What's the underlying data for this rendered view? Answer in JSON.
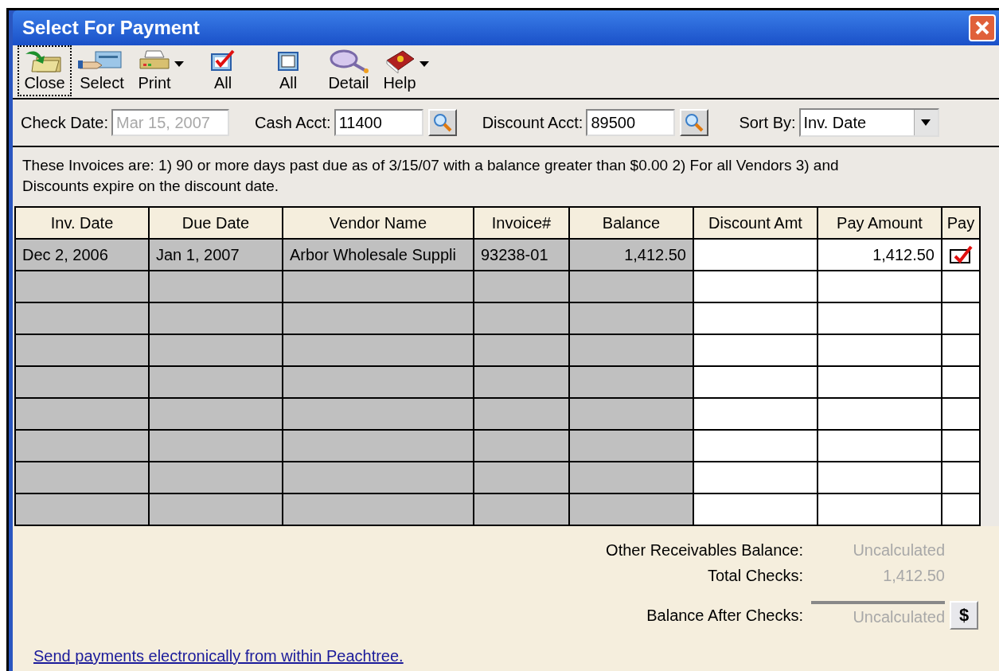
{
  "window": {
    "title": "Select For Payment"
  },
  "toolbar": [
    {
      "kind": "close",
      "label": "Close",
      "focused": true,
      "dropdown": false
    },
    {
      "kind": "select",
      "label": "Select",
      "focused": false,
      "dropdown": false
    },
    {
      "kind": "print",
      "label": "Print",
      "focused": false,
      "dropdown": true
    },
    {
      "kind": "check-all",
      "label": "All",
      "focused": false,
      "dropdown": false
    },
    {
      "kind": "uncheck-all",
      "label": "All",
      "focused": false,
      "dropdown": false
    },
    {
      "kind": "detail",
      "label": "Detail",
      "focused": false,
      "dropdown": false
    },
    {
      "kind": "help",
      "label": "Help",
      "focused": false,
      "dropdown": true
    }
  ],
  "fields": {
    "check_date": {
      "label": "Check Date:",
      "value": "Mar 15, 2007",
      "disabled": true
    },
    "cash_acct": {
      "label": "Cash Acct:",
      "value": "11400"
    },
    "discount_acct": {
      "label": "Discount Acct:",
      "value": "89500"
    },
    "sort_by": {
      "label": "Sort By:",
      "value": "Inv. Date"
    }
  },
  "description": "These Invoices are: 1) 90 or more days past due as of 3/15/07 with a balance greater than $0.00 2) For all Vendors 3) and Discounts expire on the discount date.",
  "table": {
    "columns": [
      "Inv. Date",
      "Due Date",
      "Vendor Name",
      "Invoice#",
      "Balance",
      "Discount Amt",
      "Pay Amount",
      "Pay"
    ],
    "rows": [
      {
        "inv_date": "Dec 2, 2006",
        "due_date": "Jan 1, 2007",
        "vendor_name": "Arbor Wholesale Suppli",
        "invoice": "93238-01",
        "balance": "1,412.50",
        "discount_amt": "",
        "pay_amount": "1,412.50",
        "pay": true
      }
    ]
  },
  "summary": [
    {
      "label": "Other Receivables Balance:",
      "value": "Uncalculated"
    },
    {
      "label": "Total Checks:",
      "value": "1,412.50"
    },
    {
      "label": "Balance After Checks:",
      "value": "Uncalculated"
    }
  ],
  "calc_button": "$",
  "link": "Send payments electronically from within Peachtree."
}
